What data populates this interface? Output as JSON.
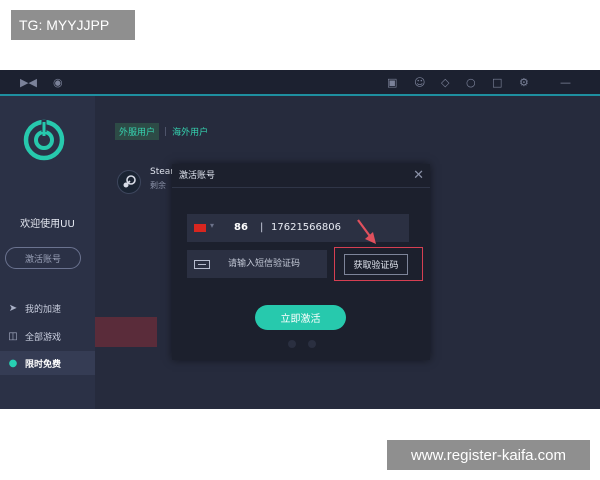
{
  "watermark_top": "TG: MYYJJPP",
  "watermark_bottom": "www.register-kaifa.com",
  "titlebar": {
    "icons": [
      "gamepad-icon",
      "bug-icon",
      "cart-icon",
      "chat-icon",
      "tag-icon",
      "headset-icon",
      "mail-icon",
      "gear-icon",
      "minimize-icon"
    ]
  },
  "sidebar": {
    "welcome": "欢迎使用UU",
    "activate_label": "激活账号",
    "menu": [
      {
        "label": "我的加速",
        "icon": "rocket-icon"
      },
      {
        "label": "全部游戏",
        "icon": "gamepad-icon"
      },
      {
        "label": "限时免费",
        "icon": "free-icon"
      }
    ]
  },
  "content": {
    "tab_domestic": "外服用户",
    "tab_overseas": "海外用户",
    "steam_name": "Steam",
    "steam_sub": "剩余"
  },
  "dialog": {
    "title": "激活账号",
    "country_code": "86",
    "separator": "|",
    "phone": "17621566806",
    "sms_placeholder": "请输入短信验证码",
    "get_code": "获取验证码",
    "activate_now": "立即激活"
  },
  "colors": {
    "accent": "#27c9ad",
    "highlight": "#d63f52",
    "bg": "#232839"
  }
}
